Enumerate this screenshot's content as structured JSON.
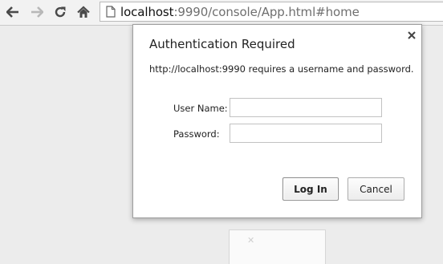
{
  "browser": {
    "url_host": "localhost",
    "url_rest": ":9990/console/App.html#home"
  },
  "icons": {
    "back": "arrow-left-icon",
    "forward": "arrow-right-icon",
    "reload": "reload-icon",
    "home": "home-icon",
    "page": "page-icon",
    "close": "close-icon"
  },
  "dialog": {
    "title": "Authentication Required",
    "message": "http://localhost:9990 requires a username and password.",
    "username_label": "User Name:",
    "username_value": "",
    "password_label": "Password:",
    "password_value": "",
    "login_label": "Log In",
    "cancel_label": "Cancel",
    "close_symbol": "×"
  }
}
